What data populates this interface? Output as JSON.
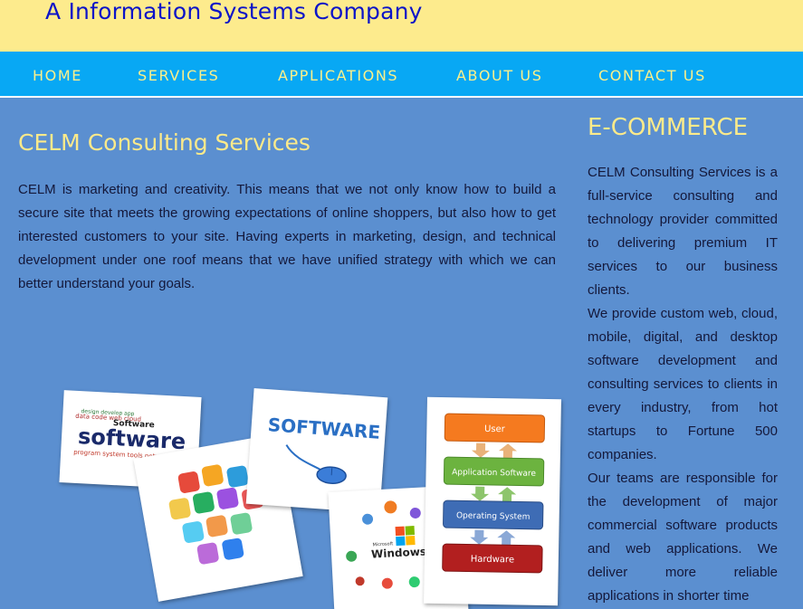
{
  "header": {
    "tagline": "A Information Systems Company"
  },
  "nav": {
    "items": [
      {
        "label": "HOME"
      },
      {
        "label": "SERVICES"
      },
      {
        "label": "APPLICATIONS"
      },
      {
        "label": "ABOUT US"
      },
      {
        "label": "CONTACT US"
      }
    ]
  },
  "main": {
    "title": "CELM Consulting Services",
    "paragraph": "CELM is marketing and creativity. This means that we not only know how to build a secure site that meets the growing expectations of online shoppers, but also how to get interested customers to your site. Having experts in marketing, design, and technical development under one roof means that we have unified strategy with which we can better understand your goals.",
    "images": {
      "wordcloud": {
        "word": "software",
        "small": "Software"
      },
      "software_card": {
        "word": "SOFTWARE"
      },
      "windows_card": {
        "logo_text": "Windows",
        "small_text": "Microsoft"
      },
      "layers": [
        "User",
        "Application Software",
        "Operating System",
        "Hardware"
      ]
    }
  },
  "sidebar": {
    "title": "E-COMMERCE",
    "paragraphs": [
      "CELM Consulting Services is a full-service consulting and technology provider committed to delivering premium IT services to our business clients.",
      "We provide custom web, cloud, mobile, digital, and desktop software development and consulting services to clients in every industry, from hot startups to Fortune 500 companies.",
      "Our teams are responsible for the development of major commercial software products and web applications. We deliver more reliable applications in shorter time"
    ]
  },
  "colors": {
    "header_bg": "#fdeb8d",
    "tagline": "#0c14c8",
    "nav_bg": "#08a8f4",
    "nav_text": "#fbf08b",
    "page_bg": "#5b8fd0",
    "heading": "#fcea8a",
    "body_text": "#14183a"
  },
  "icons": [
    "app-icons-cluster",
    "mouse-icon",
    "browser-icons"
  ]
}
